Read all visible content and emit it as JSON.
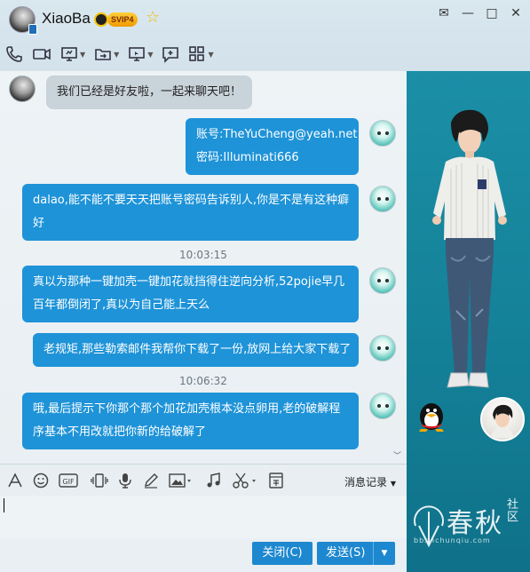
{
  "window": {
    "contact_name": "XiaoBa",
    "svip_badge": "SVIP4",
    "buttons": {
      "skin": "✉",
      "minimize": "—",
      "maximize": "□",
      "close": "✕"
    }
  },
  "toolbar": {
    "icons": [
      "phone-icon",
      "video-icon",
      "screen-share-icon",
      "file-transfer-icon",
      "remote-desktop-icon",
      "invite-icon",
      "apps-icon"
    ]
  },
  "chat": {
    "system_message": "我们已经是好友啦，一起来聊天吧！",
    "messages": [
      {
        "lines": [
          "账号:TheYuCheng@yeah.net",
          "密码:Illuminati666"
        ]
      },
      {
        "lines": [
          "dalao,能不能不要天天把账号密码告诉别人,你是不是有这种癖",
          "好"
        ]
      },
      {
        "time": "10:03:15"
      },
      {
        "lines": [
          "真以为那种一键加壳一键加花就挡得住逆向分析,52pojie早几",
          "百年都倒闭了,真以为自己能上天么"
        ]
      },
      {
        "lines": [
          "老规矩,那些勒索邮件我帮你下载了一份,放网上给大家下载了"
        ]
      },
      {
        "time": "10:06:32"
      },
      {
        "lines": [
          "哦,最后提示下你那个那个加花加壳根本没点卵用,老的破解程",
          "序基本不用改就把你新的给破解了"
        ]
      }
    ]
  },
  "input_toolbar": {
    "history_label": "消息记录",
    "gif_label": "GIF"
  },
  "actions": {
    "close_label": "关闭(C)",
    "send_label": "发送(S)"
  },
  "watermark": {
    "text": "春秋",
    "sub": "社区",
    "url": "bbs.ichunqiu.com"
  },
  "colors": {
    "bubble": "#1e93d8",
    "side_panel": "#137f96",
    "button": "#1d88cf"
  }
}
